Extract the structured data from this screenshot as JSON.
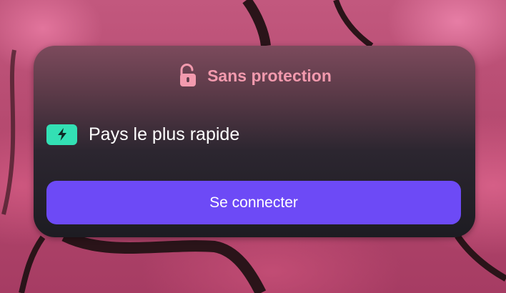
{
  "theme": {
    "status_color": "#f29aae",
    "badge_color": "#33e0b4",
    "button_color": "#6d4af6",
    "card_bottom": "#1d1c22"
  },
  "status": {
    "icon": "unlocked-padlock-icon",
    "label": "Sans protection"
  },
  "server": {
    "icon": "lightning-bolt-icon",
    "label": "Pays le plus rapide"
  },
  "connect_button": {
    "label": "Se connecter"
  }
}
